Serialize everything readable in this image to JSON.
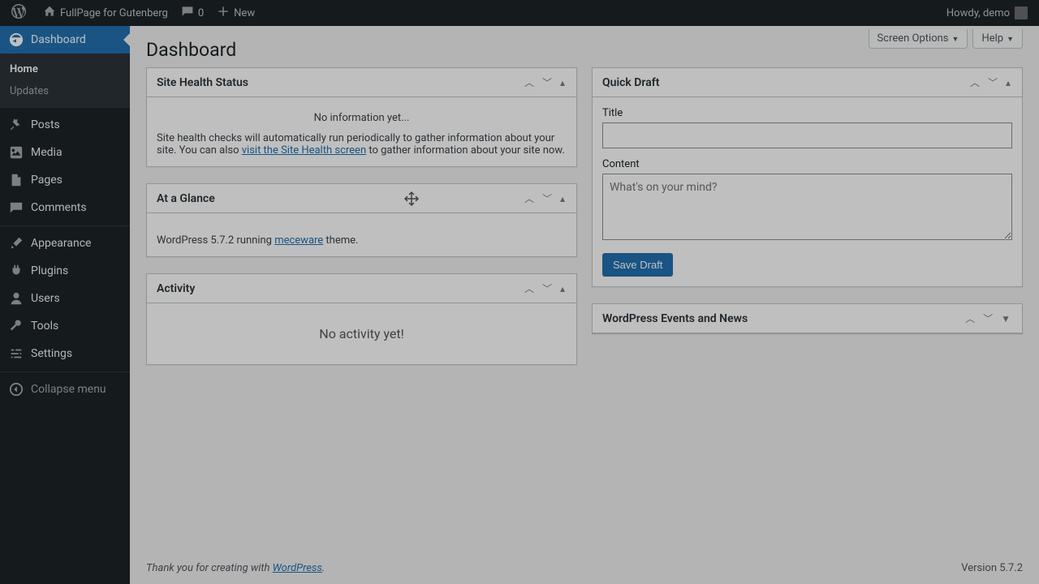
{
  "adminbar": {
    "site_name": "FullPage for Gutenberg",
    "comments_count": "0",
    "new_label": "New",
    "howdy": "Howdy, demo"
  },
  "sidebar": {
    "dashboard": "Dashboard",
    "home": "Home",
    "updates": "Updates",
    "posts": "Posts",
    "media": "Media",
    "pages": "Pages",
    "comments": "Comments",
    "appearance": "Appearance",
    "plugins": "Plugins",
    "users": "Users",
    "tools": "Tools",
    "settings": "Settings",
    "collapse": "Collapse menu"
  },
  "topright": {
    "screen_options": "Screen Options",
    "help": "Help"
  },
  "page_title": "Dashboard",
  "site_health": {
    "title": "Site Health Status",
    "no_info": "No information yet...",
    "desc_1": "Site health checks will automatically run periodically to gather information about your site. You can also ",
    "link": "visit the Site Health screen",
    "desc_2": " to gather information about your site now."
  },
  "at_a_glance": {
    "title": "At a Glance",
    "wp_text_1": "WordPress 5.7.2 running ",
    "theme_link": "meceware",
    "wp_text_2": " theme."
  },
  "activity": {
    "title": "Activity",
    "empty": "No activity yet!"
  },
  "quick_draft": {
    "title": "Quick Draft",
    "title_label": "Title",
    "content_label": "Content",
    "content_placeholder": "What's on your mind?",
    "save": "Save Draft"
  },
  "events": {
    "title": "WordPress Events and News"
  },
  "footer": {
    "thank_you_1": "Thank you for creating with ",
    "wp_link": "WordPress",
    "version": "Version 5.7.2"
  }
}
